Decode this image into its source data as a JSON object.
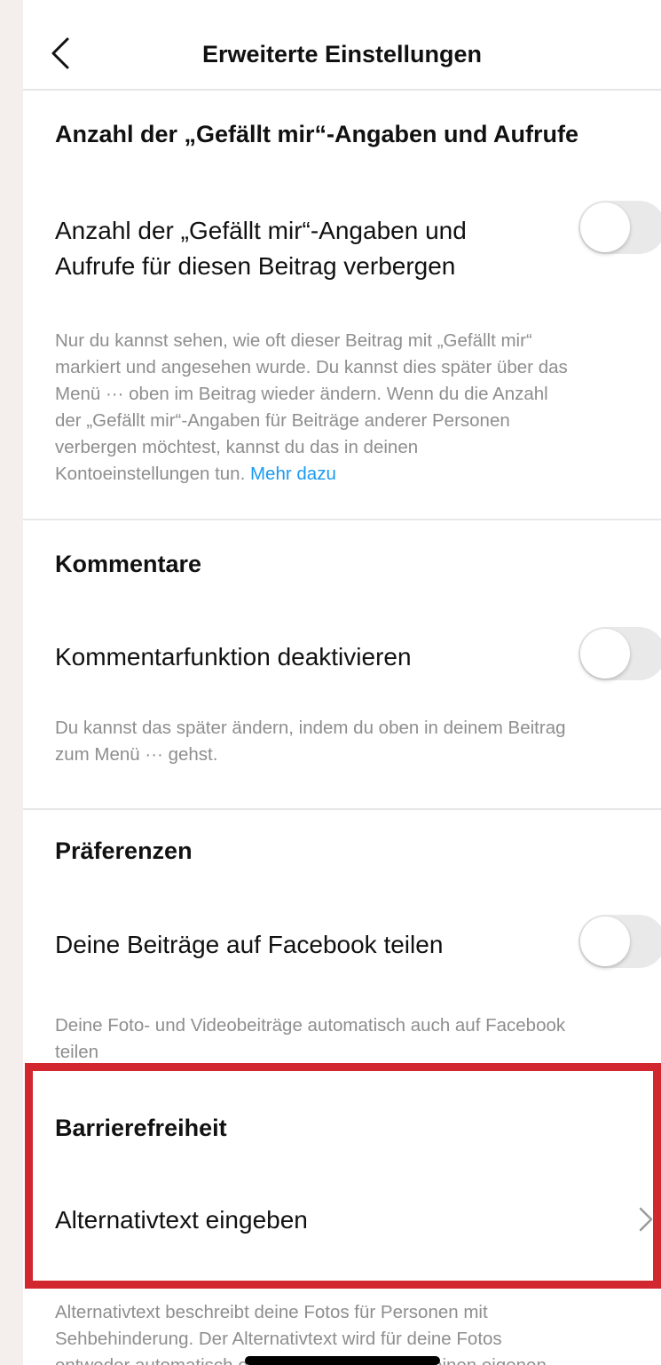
{
  "header": {
    "title": "Erweiterte Einstellungen"
  },
  "likes": {
    "title": "Anzahl der „Gefällt mir“-Angaben und Aufrufe",
    "toggle_label_line1": "Anzahl der „Gefällt mir“-Angaben und",
    "toggle_label_line2": "Aufrufe für diesen Beitrag verbergen",
    "toggle_on": false,
    "desc": [
      "Nur du kannst sehen, wie oft dieser Beitrag mit „Gefällt mir“",
      "markiert und angesehen wurde. Du kannst dies später über das",
      "Menü ··· oben im Beitrag wieder ändern. Wenn du die Anzahl",
      "der „Gefällt mir“-Angaben für Beiträge anderer Personen",
      "verbergen möchtest, kannst du das in deinen",
      "Kontoeinstellungen tun."
    ],
    "link": "Mehr dazu"
  },
  "comments": {
    "title": "Kommentare",
    "toggle_label": "Kommentarfunktion deaktivieren",
    "toggle_on": false,
    "desc": [
      "Du kannst das später ändern, indem du oben in deinem Beitrag",
      "zum Menü ··· gehst."
    ]
  },
  "preferences": {
    "title": "Präferenzen",
    "toggle_label": "Deine Beiträge auf Facebook teilen",
    "toggle_on": false,
    "desc": [
      "Deine Foto- und Videobeiträge automatisch auch auf Facebook",
      "teilen"
    ]
  },
  "accessibility": {
    "title": "Barrierefreiheit",
    "row_label": "Alternativtext eingeben",
    "desc": [
      "Alternativtext beschreibt deine Fotos für Personen mit",
      "Sehbehinderung. Der Alternativtext wird für deine Fotos",
      "entweder automatisch erstellt oder du kannst deinen eigenen"
    ]
  },
  "colors": {
    "highlight": "#d3272f",
    "link": "#1a9af0",
    "toggle_off": "#e9e9ea",
    "secondary_text": "#8e8e8e"
  },
  "icons": {
    "back": "chevron-left-icon",
    "row_arrow": "chevron-right-icon"
  }
}
